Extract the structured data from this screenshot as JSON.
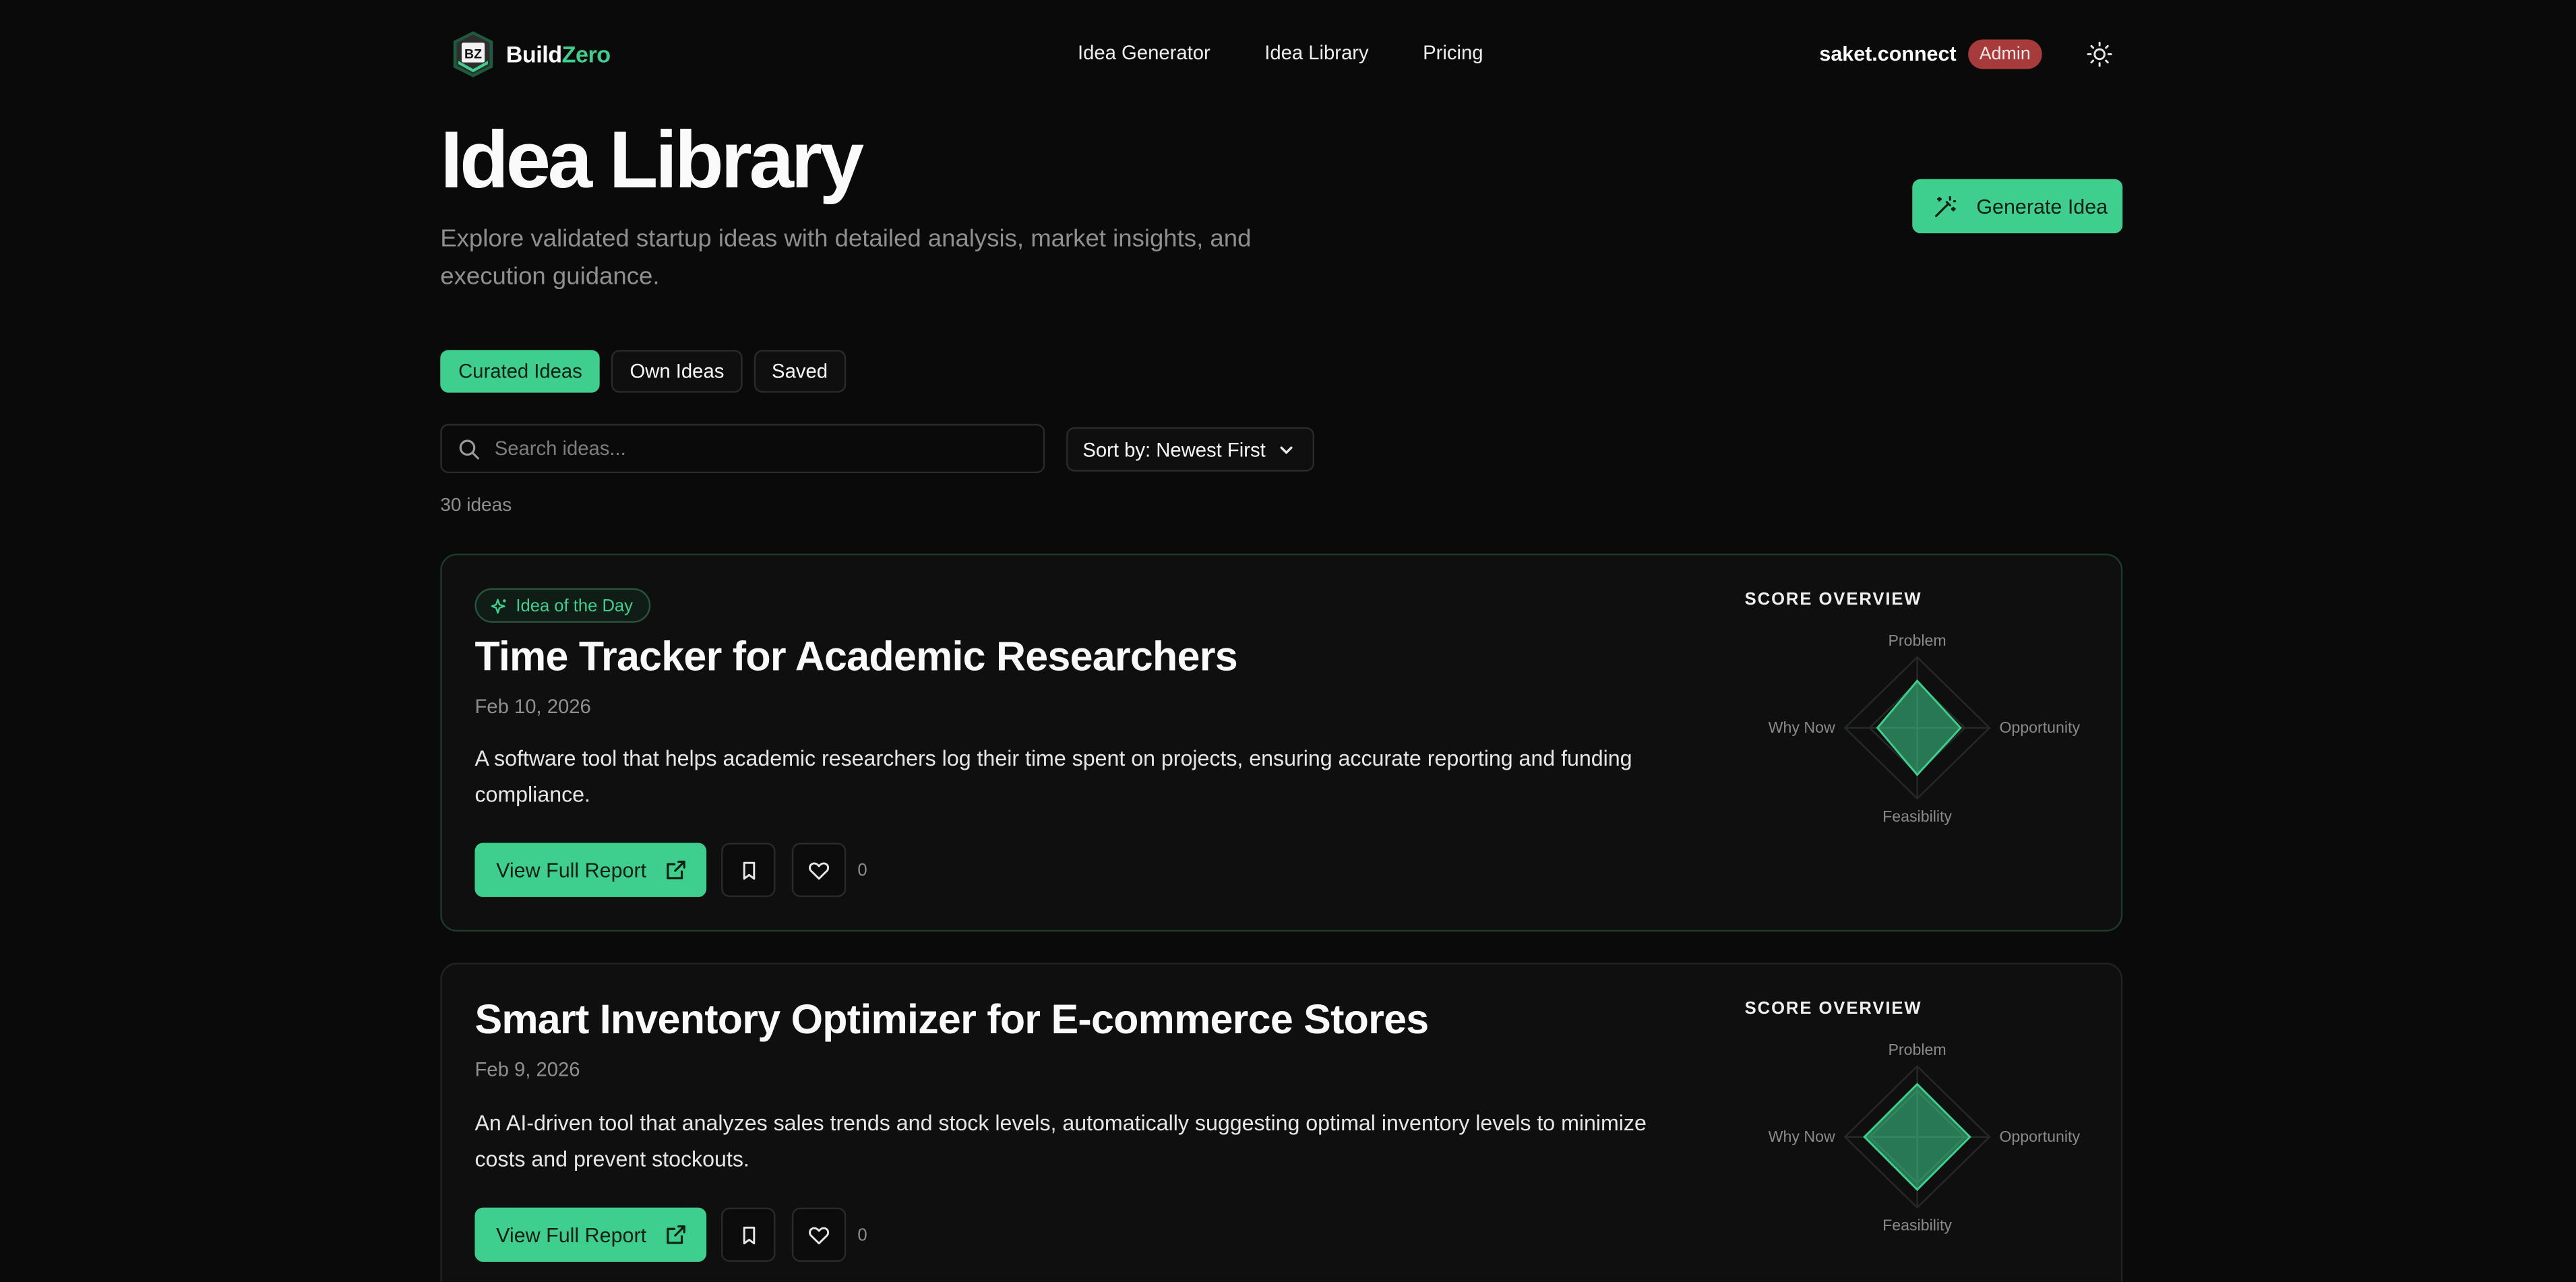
{
  "header": {
    "logo_mark": "BZ",
    "logo_first": "B",
    "logo_rest_plain": "uild",
    "logo_rest_accent": "Zero",
    "nav": [
      "Idea Generator",
      "Idea Library",
      "Pricing"
    ],
    "user_name": "saket.connect",
    "role_badge": "Admin",
    "theme_icon": "sun-icon"
  },
  "page": {
    "title": "Idea Library",
    "subtitle": "Explore validated startup ideas with detailed analysis, market insights, and execution guidance.",
    "generate_label": "Generate Idea"
  },
  "tabs": [
    {
      "label": "Curated Ideas",
      "active": true
    },
    {
      "label": "Own Ideas",
      "active": false
    },
    {
      "label": "Saved",
      "active": false
    }
  ],
  "search": {
    "placeholder": "Search ideas...",
    "value": ""
  },
  "sort": {
    "label": "Sort by: Newest First"
  },
  "count_label": "30 ideas",
  "colors": {
    "accent": "#3ecf8e",
    "admin": "#a73a3a",
    "background": "#0a0a0a"
  },
  "score_overview_label": "SCORE OVERVIEW",
  "radar_axes": [
    "Problem",
    "Opportunity",
    "Feasibility",
    "Why Now"
  ],
  "cards": [
    {
      "tag": "Idea of the Day",
      "title": "Time Tracker for Academic Researchers",
      "date": "Feb 10, 2026",
      "description": "A software tool that helps academic researchers log their time spent on projects, ensuring accurate reporting and funding compliance.",
      "button": "View Full Report",
      "likes": "0",
      "scores": {
        "Problem": 0.65,
        "Opportunity": 0.6,
        "Feasibility": 0.65,
        "Why Now": 0.55
      }
    },
    {
      "title": "Smart Inventory Optimizer for E-commerce Stores",
      "date": "Feb 9, 2026",
      "description": "An AI-driven tool that analyzes sales trends and stock levels, automatically suggesting optimal inventory levels to minimize costs and prevent stockouts.",
      "button": "View Full Report",
      "likes": "0",
      "scores": {
        "Problem": 0.73,
        "Opportunity": 0.73,
        "Feasibility": 0.73,
        "Why Now": 0.73
      }
    }
  ]
}
